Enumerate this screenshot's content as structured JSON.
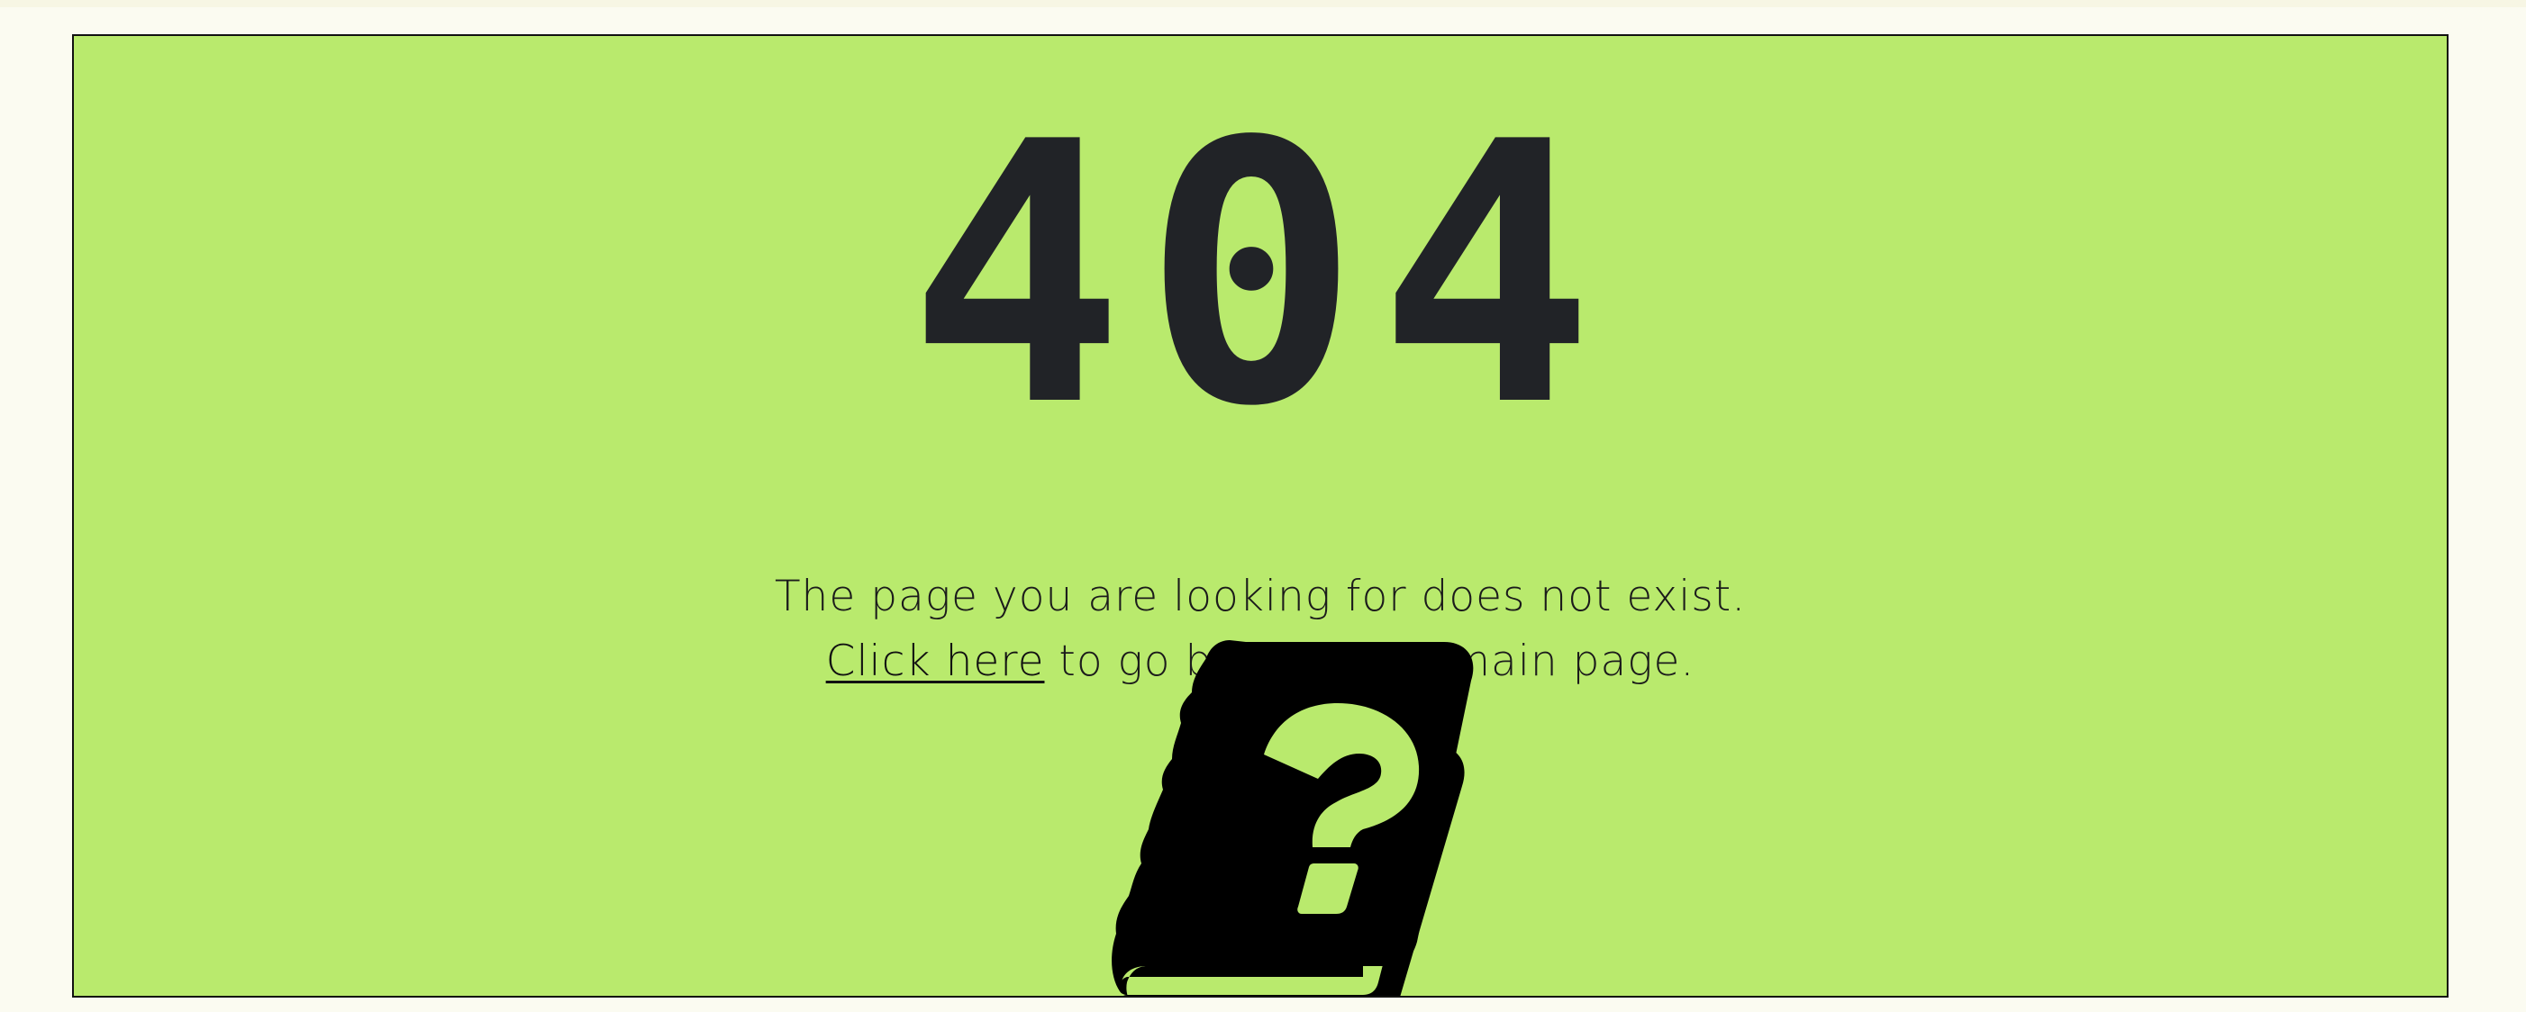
{
  "error": {
    "code": "404",
    "message_line1": "The page you are looking for does not exist.",
    "link_text": "Click here",
    "message_line2_rest": " to go back to the main page."
  },
  "icons": {
    "book": "question-book-icon"
  },
  "colors": {
    "panel_background": "#b9ea6d",
    "code_text": "#212327",
    "page_background": "#fbfbf1"
  }
}
